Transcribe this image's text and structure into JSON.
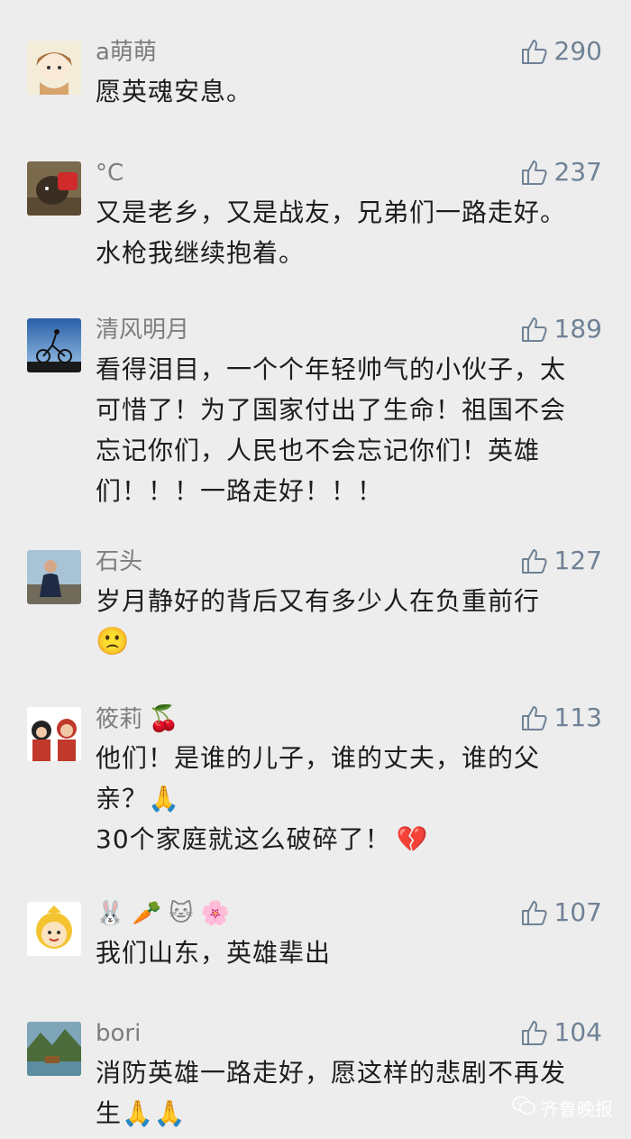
{
  "comments": [
    {
      "user": "a萌萌",
      "likes": "290",
      "text": "愿英魂安息。",
      "emoji": ""
    },
    {
      "user": "°C",
      "likes": "237",
      "text": "又是老乡，又是战友，兄弟们一路走好。水枪我继续抱着。",
      "emoji": ""
    },
    {
      "user": "清风明月",
      "likes": "189",
      "text": "看得泪目，一个个年轻帅气的小伙子，太可惜了！为了国家付出了生命！祖国不会忘记你们，人民也不会忘记你们！英雄们！！！一路走好！！！",
      "emoji": ""
    },
    {
      "user": "石头",
      "likes": "127",
      "text": "岁月静好的背后又有多少人在负重前行",
      "emoji": "🙁"
    },
    {
      "user": "筱莉",
      "name_emoji": "🍒",
      "likes": "113",
      "text": "他们！是谁的儿子，谁的丈夫，谁的父亲？",
      "text_emoji": "🙏",
      "text2": "30个家庭就这么破碎了！",
      "text2_emoji": "💔"
    },
    {
      "user": "🐰 🥕 🐱 🌸",
      "likes": "107",
      "text": "我们山东，英雄辈出",
      "emoji": ""
    },
    {
      "user": "bori",
      "likes": "104",
      "text": "消防英雄一路走好，愿这样的悲剧不再发生",
      "emoji": "🙏🙏"
    }
  ],
  "watermark": "齐鲁晚报"
}
